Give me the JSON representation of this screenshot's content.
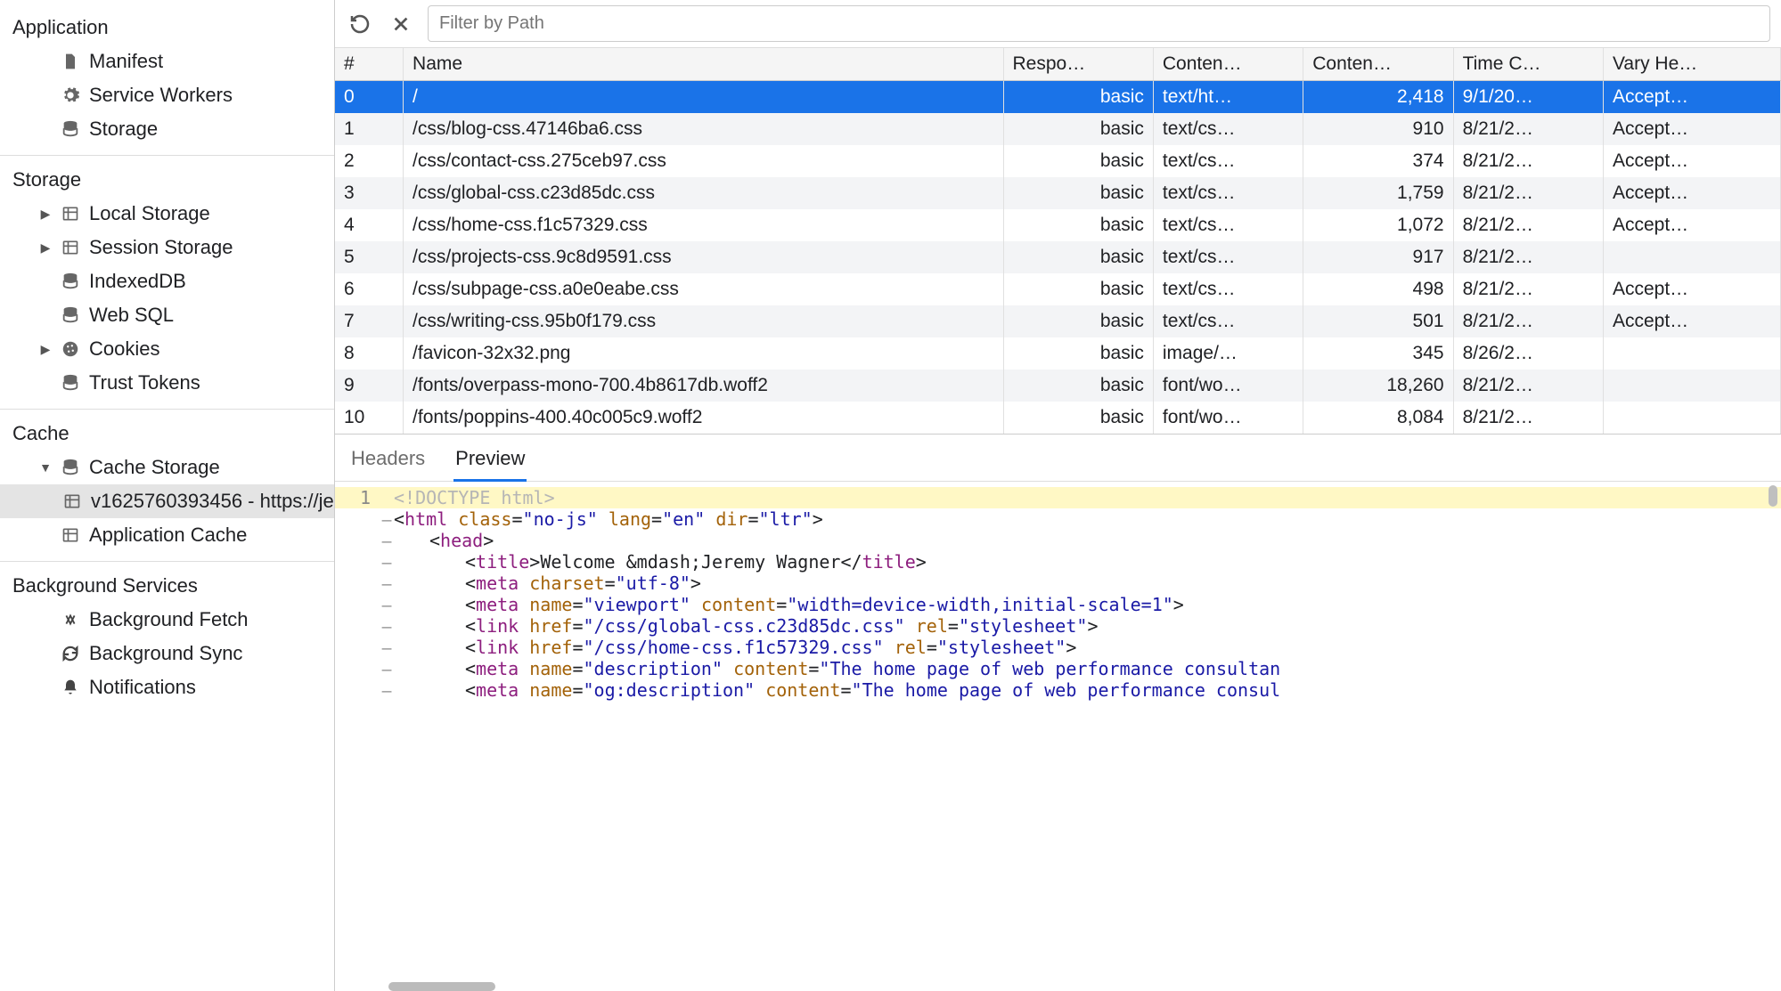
{
  "sidebar": {
    "application": {
      "title": "Application",
      "items": [
        {
          "label": "Manifest",
          "icon": "file-icon"
        },
        {
          "label": "Service Workers",
          "icon": "gear-icon"
        },
        {
          "label": "Storage",
          "icon": "database-icon"
        }
      ]
    },
    "storage": {
      "title": "Storage",
      "items": [
        {
          "label": "Local Storage",
          "icon": "table-icon",
          "expandable": true
        },
        {
          "label": "Session Storage",
          "icon": "table-icon",
          "expandable": true
        },
        {
          "label": "IndexedDB",
          "icon": "database-icon"
        },
        {
          "label": "Web SQL",
          "icon": "database-icon"
        },
        {
          "label": "Cookies",
          "icon": "cookie-icon",
          "expandable": true
        },
        {
          "label": "Trust Tokens",
          "icon": "database-icon"
        }
      ]
    },
    "cache": {
      "title": "Cache",
      "cache_storage_label": "Cache Storage",
      "cache_entry_label": "v1625760393456 - https://je",
      "app_cache_label": "Application Cache"
    },
    "background": {
      "title": "Background Services",
      "items": [
        {
          "label": "Background Fetch",
          "icon": "fetch-icon"
        },
        {
          "label": "Background Sync",
          "icon": "sync-icon"
        },
        {
          "label": "Notifications",
          "icon": "bell-icon"
        }
      ]
    }
  },
  "toolbar": {
    "filter_placeholder": "Filter by Path"
  },
  "table": {
    "headers": {
      "idx": "#",
      "name": "Name",
      "response": "Respo…",
      "content_type": "Conten…",
      "content_length": "Conten…",
      "time_cached": "Time C…",
      "vary": "Vary He…"
    },
    "rows": [
      {
        "idx": "0",
        "name": "/",
        "resp": "basic",
        "ctype": "text/ht…",
        "clen": "2,418",
        "time": "9/1/20…",
        "vary": "Accept…",
        "selected": true
      },
      {
        "idx": "1",
        "name": "/css/blog-css.47146ba6.css",
        "resp": "basic",
        "ctype": "text/cs…",
        "clen": "910",
        "time": "8/21/2…",
        "vary": "Accept…"
      },
      {
        "idx": "2",
        "name": "/css/contact-css.275ceb97.css",
        "resp": "basic",
        "ctype": "text/cs…",
        "clen": "374",
        "time": "8/21/2…",
        "vary": "Accept…"
      },
      {
        "idx": "3",
        "name": "/css/global-css.c23d85dc.css",
        "resp": "basic",
        "ctype": "text/cs…",
        "clen": "1,759",
        "time": "8/21/2…",
        "vary": "Accept…"
      },
      {
        "idx": "4",
        "name": "/css/home-css.f1c57329.css",
        "resp": "basic",
        "ctype": "text/cs…",
        "clen": "1,072",
        "time": "8/21/2…",
        "vary": "Accept…"
      },
      {
        "idx": "5",
        "name": "/css/projects-css.9c8d9591.css",
        "resp": "basic",
        "ctype": "text/cs…",
        "clen": "917",
        "time": "8/21/2…",
        "vary": ""
      },
      {
        "idx": "6",
        "name": "/css/subpage-css.a0e0eabe.css",
        "resp": "basic",
        "ctype": "text/cs…",
        "clen": "498",
        "time": "8/21/2…",
        "vary": "Accept…"
      },
      {
        "idx": "7",
        "name": "/css/writing-css.95b0f179.css",
        "resp": "basic",
        "ctype": "text/cs…",
        "clen": "501",
        "time": "8/21/2…",
        "vary": "Accept…"
      },
      {
        "idx": "8",
        "name": "/favicon-32x32.png",
        "resp": "basic",
        "ctype": "image/…",
        "clen": "345",
        "time": "8/26/2…",
        "vary": ""
      },
      {
        "idx": "9",
        "name": "/fonts/overpass-mono-700.4b8617db.woff2",
        "resp": "basic",
        "ctype": "font/wo…",
        "clen": "18,260",
        "time": "8/21/2…",
        "vary": ""
      },
      {
        "idx": "10",
        "name": "/fonts/poppins-400.40c005c9.woff2",
        "resp": "basic",
        "ctype": "font/wo…",
        "clen": "8,084",
        "time": "8/21/2…",
        "vary": ""
      }
    ]
  },
  "detail": {
    "tabs": {
      "headers": "Headers",
      "preview": "Preview"
    },
    "code_lines": [
      {
        "n": "1",
        "fold": "",
        "indent": 1,
        "hl": true,
        "tokens": [
          {
            "c": "doctype",
            "t": "<!DOCTYPE html>"
          }
        ]
      },
      {
        "n": "",
        "fold": "–",
        "indent": 1,
        "tokens": [
          {
            "c": "punct",
            "t": "<"
          },
          {
            "c": "tag",
            "t": "html"
          },
          {
            "c": "punct",
            "t": " "
          },
          {
            "c": "attr",
            "t": "class"
          },
          {
            "c": "punct",
            "t": "="
          },
          {
            "c": "str",
            "t": "\"no-js\""
          },
          {
            "c": "punct",
            "t": " "
          },
          {
            "c": "attr",
            "t": "lang"
          },
          {
            "c": "punct",
            "t": "="
          },
          {
            "c": "str",
            "t": "\"en\""
          },
          {
            "c": "punct",
            "t": " "
          },
          {
            "c": "attr",
            "t": "dir"
          },
          {
            "c": "punct",
            "t": "="
          },
          {
            "c": "str",
            "t": "\"ltr\""
          },
          {
            "c": "punct",
            "t": ">"
          }
        ]
      },
      {
        "n": "",
        "fold": "–",
        "indent": 2,
        "tokens": [
          {
            "c": "punct",
            "t": "<"
          },
          {
            "c": "tag",
            "t": "head"
          },
          {
            "c": "punct",
            "t": ">"
          }
        ]
      },
      {
        "n": "",
        "fold": "–",
        "indent": 3,
        "tokens": [
          {
            "c": "punct",
            "t": "<"
          },
          {
            "c": "tag",
            "t": "title"
          },
          {
            "c": "punct",
            "t": ">"
          },
          {
            "c": "punct",
            "t": "Welcome &mdash;Jeremy Wagner"
          },
          {
            "c": "punct",
            "t": "</"
          },
          {
            "c": "tag",
            "t": "title"
          },
          {
            "c": "punct",
            "t": ">"
          }
        ]
      },
      {
        "n": "",
        "fold": "–",
        "indent": 3,
        "tokens": [
          {
            "c": "punct",
            "t": "<"
          },
          {
            "c": "tag",
            "t": "meta"
          },
          {
            "c": "punct",
            "t": " "
          },
          {
            "c": "attr",
            "t": "charset"
          },
          {
            "c": "punct",
            "t": "="
          },
          {
            "c": "str",
            "t": "\"utf-8\""
          },
          {
            "c": "punct",
            "t": ">"
          }
        ]
      },
      {
        "n": "",
        "fold": "–",
        "indent": 3,
        "tokens": [
          {
            "c": "punct",
            "t": "<"
          },
          {
            "c": "tag",
            "t": "meta"
          },
          {
            "c": "punct",
            "t": " "
          },
          {
            "c": "attr",
            "t": "name"
          },
          {
            "c": "punct",
            "t": "="
          },
          {
            "c": "str",
            "t": "\"viewport\""
          },
          {
            "c": "punct",
            "t": " "
          },
          {
            "c": "attr",
            "t": "content"
          },
          {
            "c": "punct",
            "t": "="
          },
          {
            "c": "str",
            "t": "\"width=device-width,initial-scale=1\""
          },
          {
            "c": "punct",
            "t": ">"
          }
        ]
      },
      {
        "n": "",
        "fold": "–",
        "indent": 3,
        "tokens": [
          {
            "c": "punct",
            "t": "<"
          },
          {
            "c": "tag",
            "t": "link"
          },
          {
            "c": "punct",
            "t": " "
          },
          {
            "c": "attr",
            "t": "href"
          },
          {
            "c": "punct",
            "t": "="
          },
          {
            "c": "str",
            "t": "\"/css/global-css.c23d85dc.css\""
          },
          {
            "c": "punct",
            "t": " "
          },
          {
            "c": "attr",
            "t": "rel"
          },
          {
            "c": "punct",
            "t": "="
          },
          {
            "c": "str",
            "t": "\"stylesheet\""
          },
          {
            "c": "punct",
            "t": ">"
          }
        ]
      },
      {
        "n": "",
        "fold": "–",
        "indent": 3,
        "tokens": [
          {
            "c": "punct",
            "t": "<"
          },
          {
            "c": "tag",
            "t": "link"
          },
          {
            "c": "punct",
            "t": " "
          },
          {
            "c": "attr",
            "t": "href"
          },
          {
            "c": "punct",
            "t": "="
          },
          {
            "c": "str",
            "t": "\"/css/home-css.f1c57329.css\""
          },
          {
            "c": "punct",
            "t": " "
          },
          {
            "c": "attr",
            "t": "rel"
          },
          {
            "c": "punct",
            "t": "="
          },
          {
            "c": "str",
            "t": "\"stylesheet\""
          },
          {
            "c": "punct",
            "t": ">"
          }
        ]
      },
      {
        "n": "",
        "fold": "–",
        "indent": 3,
        "tokens": [
          {
            "c": "punct",
            "t": "<"
          },
          {
            "c": "tag",
            "t": "meta"
          },
          {
            "c": "punct",
            "t": " "
          },
          {
            "c": "attr",
            "t": "name"
          },
          {
            "c": "punct",
            "t": "="
          },
          {
            "c": "str",
            "t": "\"description\""
          },
          {
            "c": "punct",
            "t": " "
          },
          {
            "c": "attr",
            "t": "content"
          },
          {
            "c": "punct",
            "t": "="
          },
          {
            "c": "str",
            "t": "\"The home page of web performance consultan"
          }
        ]
      },
      {
        "n": "",
        "fold": "–",
        "indent": 3,
        "tokens": [
          {
            "c": "punct",
            "t": "<"
          },
          {
            "c": "tag",
            "t": "meta"
          },
          {
            "c": "punct",
            "t": " "
          },
          {
            "c": "attr",
            "t": "name"
          },
          {
            "c": "punct",
            "t": "="
          },
          {
            "c": "str",
            "t": "\"og:description\""
          },
          {
            "c": "punct",
            "t": " "
          },
          {
            "c": "attr",
            "t": "content"
          },
          {
            "c": "punct",
            "t": "="
          },
          {
            "c": "str",
            "t": "\"The home page of web performance consul"
          }
        ]
      }
    ]
  }
}
